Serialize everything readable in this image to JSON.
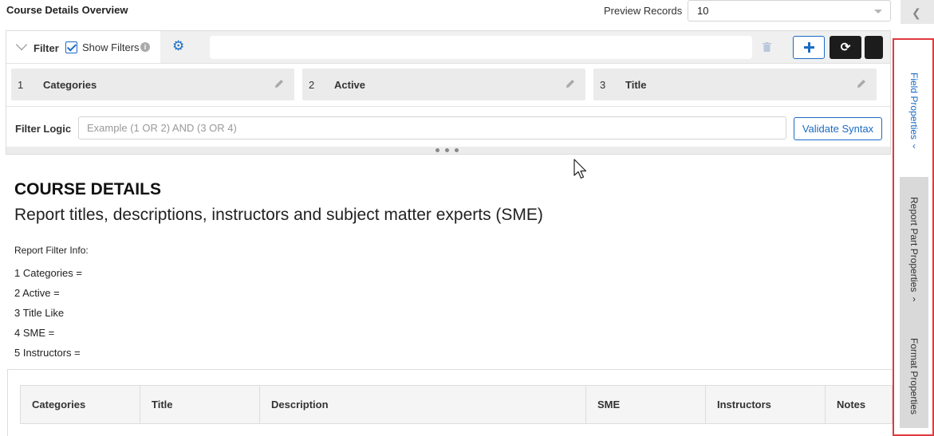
{
  "header": {
    "title": "Course Details Overview",
    "preview_label": "Preview Records",
    "preview_value": "10"
  },
  "filter": {
    "label": "Filter",
    "show_filters_label": "Show Filters",
    "show_filters_checked": true,
    "search_value": "",
    "chips": [
      {
        "num": "1",
        "label": "Categories"
      },
      {
        "num": "2",
        "label": "Active"
      },
      {
        "num": "3",
        "label": "Title"
      }
    ],
    "logic_label": "Filter Logic",
    "logic_placeholder": "Example (1 OR 2) AND (3 OR 4)",
    "validate_label": "Validate Syntax"
  },
  "report": {
    "title": "COURSE DETAILS",
    "subtitle": "Report titles, descriptions, instructors and subject matter experts (SME)",
    "filter_info_title": "Report Filter Info:",
    "filter_info": [
      "1 Categories =",
      "2 Active =",
      "3 Title Like",
      "4 SME =",
      "5 Instructors ="
    ]
  },
  "table": {
    "columns": [
      "Categories",
      "Title",
      "Description",
      "SME",
      "Instructors",
      "Notes"
    ]
  },
  "side_panel": {
    "tabs": [
      "Field Properties",
      "Report Part Properties",
      "Format Properties"
    ],
    "active_tab": "Field Properties"
  },
  "colors": {
    "accent": "#1a6bc4",
    "highlight": "#e0393e",
    "dark_button": "#1c1c1c"
  },
  "icons": [
    "chevron-down-icon",
    "checkbox-icon",
    "info-icon",
    "gear-icon",
    "trash-icon",
    "plus-icon",
    "refresh-icon",
    "pencil-icon",
    "chevron-left-icon",
    "mouse-cursor-icon"
  ]
}
